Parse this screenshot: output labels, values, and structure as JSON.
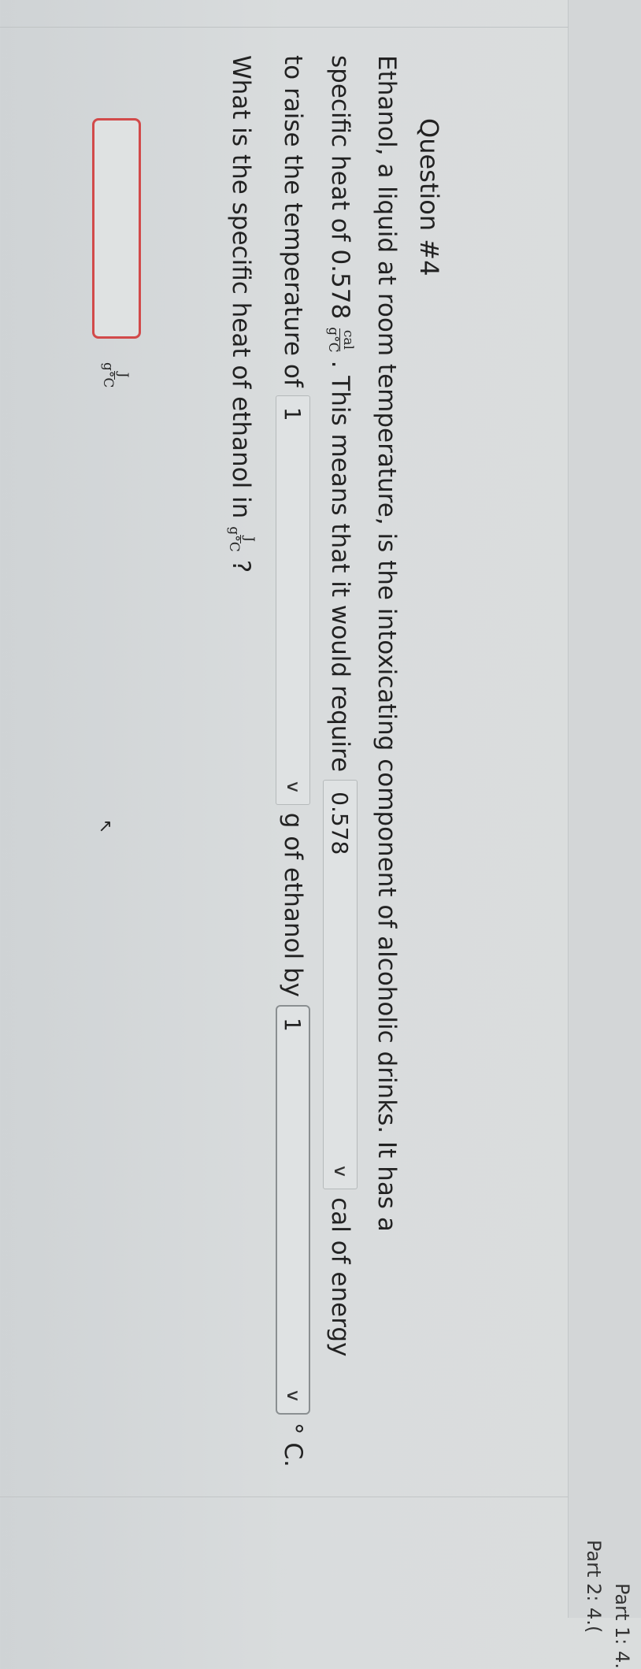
{
  "parts": {
    "part1": "Part 1: 4.",
    "part2": "Part 2: 4.("
  },
  "question": {
    "title": "Question #4",
    "line1": "Ethanol, a liquid at room temperature, is the intoxicating component of alcoholic drinks. It has a",
    "line2_a": "specific heat of 0.578",
    "line2_b": ". This means that it would require",
    "line2_c": "cal of energy",
    "line3_a": "to raise the temperature of",
    "line3_b": "g of ethanol by",
    "line3_c": "° C.",
    "line4_a": "What is the specific heat of ethanol in",
    "line4_b": "?",
    "frac_cal": {
      "num": "cal",
      "den": "g°C"
    },
    "frac_J": {
      "num": "J",
      "den": "g°C"
    }
  },
  "dropdowns": {
    "energy": "0.578",
    "mass": "1",
    "temp": "1"
  },
  "icons": {
    "chevron": "chevron-down-icon",
    "cursor": "mouse-pointer-icon"
  },
  "colors": {
    "answer_border": "#d24a4a"
  }
}
